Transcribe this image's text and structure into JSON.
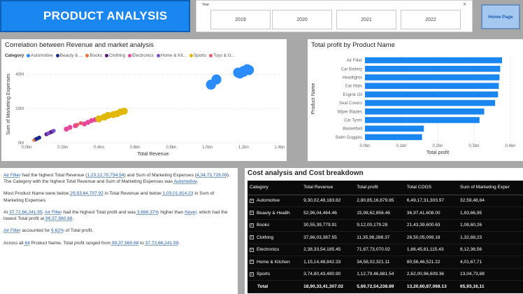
{
  "header": {
    "title": "PRODUCT ANALYSIS",
    "home_label": "Home Page"
  },
  "year_slicer": {
    "label": "Year",
    "options": [
      "2019",
      "2020",
      "2021",
      "2022"
    ]
  },
  "scatter": {
    "title": "Correlation between Revenue and market analysis",
    "legend_title": "Category",
    "legend": [
      {
        "name": "Automotive",
        "color": "#2b8cff"
      },
      {
        "name": "Beauty & ...",
        "color": "#1a2a8a"
      },
      {
        "name": "Books",
        "color": "#f0703a"
      },
      {
        "name": "Clothing",
        "color": "#5a1878"
      },
      {
        "name": "Electronics",
        "color": "#e8489a"
      },
      {
        "name": "Home & Kit...",
        "color": "#7a4ed0"
      },
      {
        "name": "Sports",
        "color": "#e0b800"
      },
      {
        "name": "Toys & G...",
        "color": "#e85a66"
      }
    ],
    "x_label": "Total Revenue",
    "y_label": "Sum of Marketing Expenses",
    "x_ticks": [
      "0.0bn",
      "0.2bn",
      "0.4bn",
      "0.6bn",
      "0.8bn",
      "1.0bn",
      "1.2bn",
      "1.4bn"
    ],
    "y_ticks": [
      "0M",
      "20M",
      "40M"
    ]
  },
  "bar": {
    "title": "Total profit by Product Name",
    "x_label": "Total profit",
    "y_label": "Product Name",
    "x_ticks": [
      "0.0bn",
      "0.1bn",
      "0.2bn",
      "0.3bn",
      "0.4bn"
    ],
    "color": "#1a86f0"
  },
  "chart_data": [
    {
      "type": "scatter",
      "title": "Correlation between Revenue and market analysis",
      "xlabel": "Total Revenue",
      "ylabel": "Sum of Marketing Expenses",
      "xlim": [
        0,
        1.4
      ],
      "ylim": [
        0,
        45
      ],
      "x_unit": "bn",
      "y_unit": "M",
      "series": [
        {
          "name": "Automotive",
          "color": "#2b8cff",
          "size": 10,
          "points": [
            [
              1.02,
              34
            ],
            [
              1.05,
              37
            ],
            [
              1.17,
              41
            ],
            [
              1.2,
              42
            ],
            [
              1.22,
              43
            ],
            [
              1.2,
              41.5
            ],
            [
              1.23,
              42.5
            ],
            [
              1.18,
              40.5
            ]
          ]
        },
        {
          "name": "Beauty & ...",
          "color": "#1a2a8a",
          "size": 4,
          "points": [
            [
              0.05,
              2
            ],
            [
              0.06,
              2.5
            ],
            [
              0.07,
              3
            ]
          ]
        },
        {
          "name": "Books",
          "color": "#f0703a",
          "size": 3,
          "points": [
            [
              0.04,
              1.5
            ]
          ]
        },
        {
          "name": "Clothing",
          "color": "#5a1878",
          "size": 4,
          "points": [
            [
              0.11,
              5
            ],
            [
              0.14,
              6.5
            ],
            [
              0.13,
              6
            ]
          ]
        },
        {
          "name": "Electronics",
          "color": "#e8489a",
          "size": 5,
          "points": [
            [
              0.22,
              8
            ],
            [
              0.24,
              9
            ],
            [
              0.27,
              10
            ],
            [
              0.32,
              11
            ],
            [
              0.34,
              12
            ],
            [
              0.36,
              13
            ],
            [
              0.38,
              13.5
            ]
          ]
        },
        {
          "name": "Home & Kit...",
          "color": "#7a4ed0",
          "size": 4,
          "points": [
            [
              0.12,
              5.5
            ],
            [
              0.15,
              7
            ]
          ]
        },
        {
          "name": "Sports",
          "color": "#e0b800",
          "size": 7,
          "points": [
            [
              0.4,
              14
            ],
            [
              0.43,
              15
            ],
            [
              0.45,
              16
            ],
            [
              0.48,
              16.5
            ],
            [
              0.5,
              17
            ],
            [
              0.52,
              18
            ],
            [
              0.54,
              18.5
            ]
          ]
        },
        {
          "name": "Toys & G...",
          "color": "#e85a66",
          "size": 4,
          "points": [
            [
              0.28,
              10.5
            ],
            [
              0.3,
              11.5
            ]
          ]
        }
      ]
    },
    {
      "type": "bar",
      "orientation": "horizontal",
      "title": "Total profit by Product Name",
      "xlabel": "Total profit",
      "ylabel": "Product Name",
      "xlim": [
        0,
        0.4
      ],
      "x_unit": "bn",
      "categories": [
        "Air Filter",
        "Car Battery",
        "Headlights",
        "Car Mats",
        "Engine Oil",
        "Seat Covers",
        "Wiper Blades",
        "Car Tyres",
        "Basketball",
        "Swim Goggles"
      ],
      "values": [
        0.377,
        0.372,
        0.37,
        0.368,
        0.366,
        0.358,
        0.328,
        0.315,
        0.162,
        0.157
      ]
    }
  ],
  "narrative": [
    {
      "parts": [
        {
          "t": "Air Filter",
          "hl": true
        },
        {
          "t": " had the highest Total Revenue ("
        },
        {
          "t": "1,23,12,70,734.54",
          "hl": true
        },
        {
          "t": ") and Sum of Marketing Expenses ("
        },
        {
          "t": "4,34,73,728.09",
          "hl": true
        },
        {
          "t": "). The Category with the highest Total Revenue and Sum of Marketing Expenses was "
        },
        {
          "t": "Automotive",
          "hl": true
        },
        {
          "t": "."
        }
      ]
    },
    {
      "parts": [
        {
          "t": "Most Product Name were below "
        },
        {
          "t": "29,53,64,707.92",
          "hl": true
        },
        {
          "t": " in Total Revenue and below "
        },
        {
          "t": "1,03,01,814.23",
          "hl": true
        },
        {
          "t": " in Sum of Marketing Expenses."
        }
      ]
    },
    {
      "parts": [
        {
          "t": "At "
        },
        {
          "t": "37,72,66,241.59",
          "hl": true
        },
        {
          "t": ", "
        },
        {
          "t": "Air Filter",
          "hl": true
        },
        {
          "t": " had the highest Total profit and was "
        },
        {
          "t": "3,696.37%",
          "hl": true
        },
        {
          "t": " higher than "
        },
        {
          "t": "Novel",
          "hl": true
        },
        {
          "t": ", which had the lowest Total profit at "
        },
        {
          "t": "99,37,560.68",
          "hl": true
        },
        {
          "t": "."
        }
      ]
    },
    {
      "parts": [
        {
          "t": "Air Filter",
          "hl": true
        },
        {
          "t": " accounted for "
        },
        {
          "t": "6.62%",
          "hl": true
        },
        {
          "t": " of Total profit."
        }
      ]
    },
    {
      "parts": [
        {
          "t": "Across all "
        },
        {
          "t": "64",
          "hl": true
        },
        {
          "t": " Product Name, Total profit ranged from "
        },
        {
          "t": "99,37,560.68",
          "hl": true
        },
        {
          "t": " to "
        },
        {
          "t": "37,72,66,241.59",
          "hl": true
        },
        {
          "t": "."
        }
      ]
    }
  ],
  "cost_table": {
    "title": "Cost analysis and Cost breakdown",
    "columns": [
      "Category",
      "Total Revenue",
      "Total profit",
      "Total COGS",
      "Sum of Marketing Exper"
    ],
    "rows": [
      [
        "Automotive",
        "9,30,02,48,183.82",
        "2,80,85,16,879.85",
        "6,49,17,31,303.97",
        "32,59,48,84"
      ],
      [
        "Beauty & Health",
        "52,96,04,464.46",
        "15,98,62,856.46",
        "36,97,41,608.00",
        "1,83,66,95"
      ],
      [
        "Books",
        "30,55,39,779.91",
        "9,12,00,179.28",
        "21,43,39,600.63",
        "1,08,60,26"
      ],
      [
        "Clothing",
        "37,86,03,387.55",
        "11,35,98,288.37",
        "26,50,05,099.18",
        "1,32,88,23"
      ],
      [
        "Electronics",
        "2,38,33,54,185.45",
        "71,87,73,070.02",
        "1,66,45,81,115.43",
        "8,12,36,56"
      ],
      [
        "Home & Kitchen",
        "1,15,14,48,842.33",
        "34,58,02,321.11",
        "80,56,46,521.22",
        "4,01,67,71"
      ],
      [
        "Sports",
        "3,74,80,43,490.90",
        "1,12,79,46,881.54",
        "2,62,00,96,609.36",
        "13,04,73,88"
      ]
    ],
    "total": [
      "Total",
      "18,90,33,41,307.02",
      "5,69,72,54,238.89",
      "13,20,60,87,068.13",
      "65,93,16,11"
    ]
  }
}
